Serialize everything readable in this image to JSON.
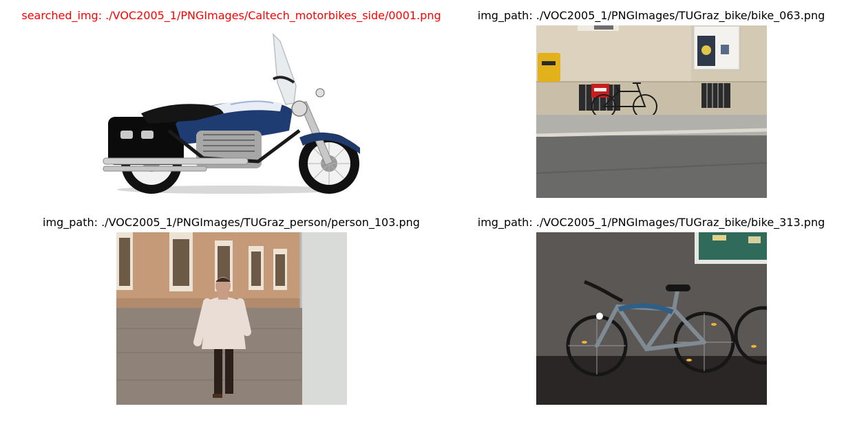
{
  "figure": {
    "panels": [
      {
        "caption": "searched_img: ./VOC2005_1/PNGImages/Caltech_motorbikes_side/0001.png",
        "caption_color": "#ff0000",
        "subject": "motorbike"
      },
      {
        "caption": "img_path: ./VOC2005_1/PNGImages/TUGraz_bike/bike_063.png",
        "caption_color": "#000000",
        "subject": "bike-street"
      },
      {
        "caption": "img_path: ./VOC2005_1/PNGImages/TUGraz_person/person_103.png",
        "caption_color": "#000000",
        "subject": "person"
      },
      {
        "caption": "img_path: ./VOC2005_1/PNGImages/TUGraz_bike/bike_313.png",
        "caption_color": "#000000",
        "subject": "bike-night"
      }
    ]
  }
}
